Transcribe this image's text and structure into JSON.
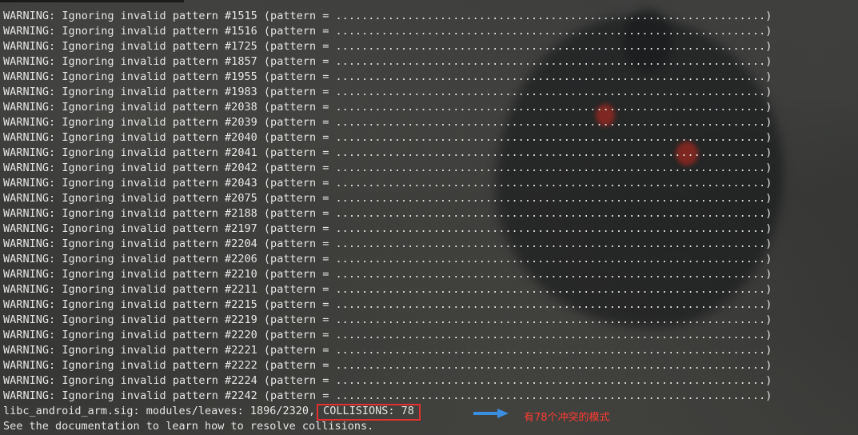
{
  "terminal": {
    "warnings": [
      {
        "text": "WARNING: Ignoring invalid pattern #1515 (pattern = ..................................................................)"
      },
      {
        "text": "WARNING: Ignoring invalid pattern #1516 (pattern = ..................................................................)"
      },
      {
        "text": "WARNING: Ignoring invalid pattern #1725 (pattern = ..................................................................)"
      },
      {
        "text": "WARNING: Ignoring invalid pattern #1857 (pattern = ..................................................................)"
      },
      {
        "text": "WARNING: Ignoring invalid pattern #1955 (pattern = ..................................................................)"
      },
      {
        "text": "WARNING: Ignoring invalid pattern #1983 (pattern = ..................................................................)"
      },
      {
        "text": "WARNING: Ignoring invalid pattern #2038 (pattern = ..................................................................)"
      },
      {
        "text": "WARNING: Ignoring invalid pattern #2039 (pattern = ..................................................................)"
      },
      {
        "text": "WARNING: Ignoring invalid pattern #2040 (pattern = ..................................................................)"
      },
      {
        "text": "WARNING: Ignoring invalid pattern #2041 (pattern = ..................................................................)"
      },
      {
        "text": "WARNING: Ignoring invalid pattern #2042 (pattern = ..................................................................)"
      },
      {
        "text": "WARNING: Ignoring invalid pattern #2043 (pattern = ..................................................................)"
      },
      {
        "text": "WARNING: Ignoring invalid pattern #2075 (pattern = ..................................................................)"
      },
      {
        "text": "WARNING: Ignoring invalid pattern #2188 (pattern = ..................................................................)"
      },
      {
        "text": "WARNING: Ignoring invalid pattern #2197 (pattern = ..................................................................)"
      },
      {
        "text": "WARNING: Ignoring invalid pattern #2204 (pattern = ..................................................................)"
      },
      {
        "text": "WARNING: Ignoring invalid pattern #2206 (pattern = ..................................................................)"
      },
      {
        "text": "WARNING: Ignoring invalid pattern #2210 (pattern = ..................................................................)"
      },
      {
        "text": "WARNING: Ignoring invalid pattern #2211 (pattern = ..................................................................)"
      },
      {
        "text": "WARNING: Ignoring invalid pattern #2215 (pattern = ..................................................................)"
      },
      {
        "text": "WARNING: Ignoring invalid pattern #2219 (pattern = ..................................................................)"
      },
      {
        "text": "WARNING: Ignoring invalid pattern #2220 (pattern = ..................................................................)"
      },
      {
        "text": "WARNING: Ignoring invalid pattern #2221 (pattern = ..................................................................)"
      },
      {
        "text": "WARNING: Ignoring invalid pattern #2222 (pattern = ..................................................................)"
      },
      {
        "text": "WARNING: Ignoring invalid pattern #2224 (pattern = ..................................................................)"
      },
      {
        "text": "WARNING: Ignoring invalid pattern #2242 (pattern = ..................................................................)"
      }
    ],
    "summary_prefix": "libc_android_arm.sig: modules/leaves: 1896/2320,",
    "collisions_label": "COLLISIONS: 78",
    "doc_line": "See the documentation to learn how to resolve collisions."
  },
  "annotation": {
    "text": "有78个冲突的模式",
    "color": "#ff3b30",
    "arrow_color": "#3a8fe0",
    "box_color": "#e53030"
  },
  "colors": {
    "terminal_text": "#e6e6e6"
  }
}
